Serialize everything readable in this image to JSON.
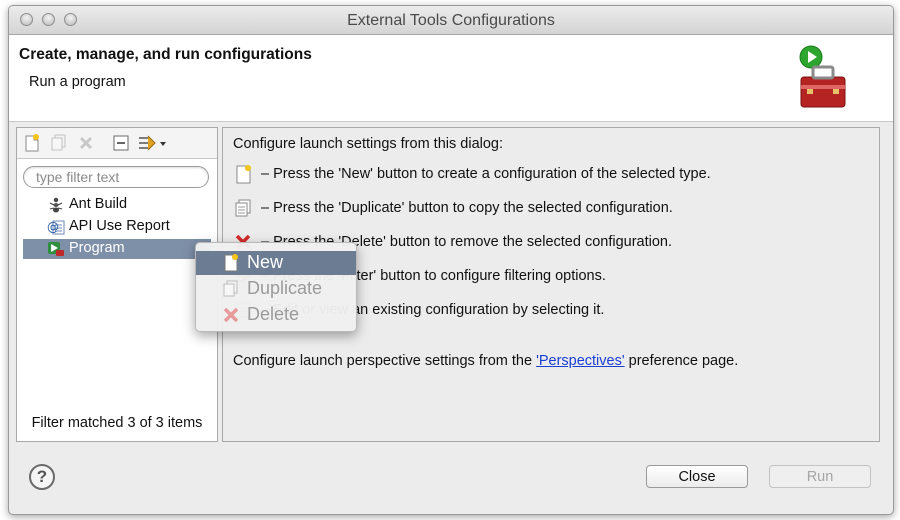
{
  "window": {
    "title": "External Tools Configurations"
  },
  "header": {
    "title": "Create, manage, and run configurations",
    "subtitle": "Run a program",
    "icon": "toolbox-run-icon"
  },
  "left_panel": {
    "toolbar": {
      "icons": [
        "new-config-icon",
        "duplicate-icon",
        "delete-icon",
        "collapse-all-icon",
        "filter-icon"
      ]
    },
    "filter_placeholder": "type filter text",
    "tree": [
      {
        "label": "Ant Build",
        "icon": "ant-icon"
      },
      {
        "label": "API Use Report",
        "icon": "api-report-icon"
      },
      {
        "label": "Program",
        "icon": "program-icon",
        "selected": true
      }
    ],
    "status": "Filter matched 3 of 3 items"
  },
  "right_panel": {
    "intro": "Configure launch settings from this dialog:",
    "lines": [
      "– Press the 'New' button to create a configuration of the selected type.",
      "– Press the 'Duplicate' button to copy the selected configuration.",
      "– Press the 'Delete' button to remove the selected configuration.",
      "– Press the 'Filter' button to configure filtering options.",
      "– Edit or view an existing configuration by selecting it."
    ],
    "perspective_prefix": "Configure launch perspective settings from the",
    "perspective_link": "'Perspectives'",
    "perspective_suffix": "preference page."
  },
  "context_menu": {
    "items": [
      {
        "label": "New",
        "icon": "new-config-icon",
        "highlighted": true
      },
      {
        "label": "Duplicate",
        "icon": "duplicate-icon",
        "disabled": true
      },
      {
        "label": "Delete",
        "icon": "delete-icon",
        "disabled": true
      }
    ]
  },
  "footer": {
    "help_label": "?",
    "close_label": "Close",
    "run_label": "Run"
  }
}
